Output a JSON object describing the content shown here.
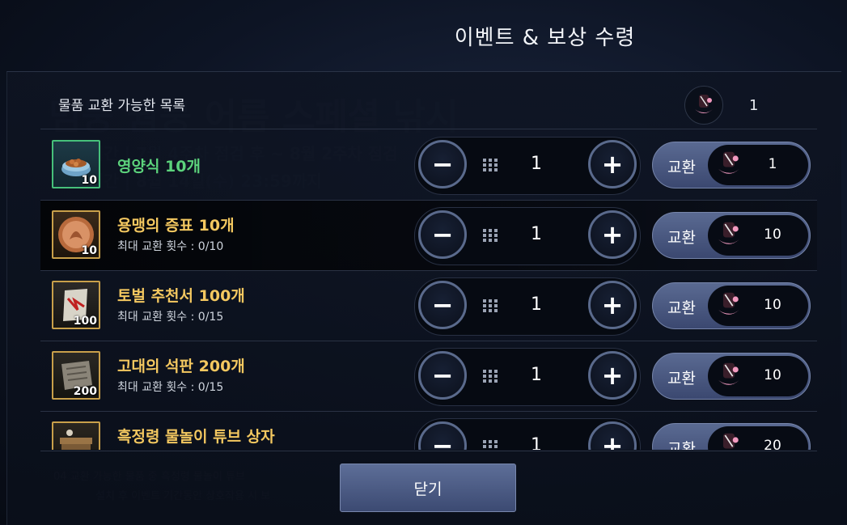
{
  "dialog": {
    "title": "이벤트 & 보상 수령",
    "list_header": "물품 교환 가능한 목록",
    "token_icon": "fishing-bait-token-icon",
    "token_count": "1",
    "close_label": "닫기"
  },
  "items": [
    {
      "name": "영양식 10개",
      "limit": "",
      "icon_qty": "10",
      "icon": "pet-food-bowl-icon",
      "quantity": "1",
      "exchange_label": "교환",
      "cost": "1"
    },
    {
      "name": "용맹의 증표 10개",
      "limit": "최대 교환 횟수 : 0/10",
      "icon_qty": "10",
      "icon": "bravery-medal-icon",
      "quantity": "1",
      "exchange_label": "교환",
      "cost": "10"
    },
    {
      "name": "토벌 추천서 100개",
      "limit": "최대 교환 횟수 : 0/15",
      "icon_qty": "100",
      "icon": "recommendation-scroll-icon",
      "quantity": "1",
      "exchange_label": "교환",
      "cost": "10"
    },
    {
      "name": "고대의 석판 200개",
      "limit": "최대 교환 횟수 : 0/15",
      "icon_qty": "200",
      "icon": "ancient-tablet-icon",
      "quantity": "1",
      "exchange_label": "교환",
      "cost": "10"
    },
    {
      "name": "흑정령 물놀이 튜브 상자",
      "limit": "",
      "icon_qty": "",
      "icon": "tube-box-icon",
      "quantity": "1",
      "exchange_label": "교환",
      "cost": "20"
    }
  ],
  "colors": {
    "accent_gold": "#f4c860",
    "accent_green": "#5cd37c",
    "button_blue": "#4a5880"
  }
}
